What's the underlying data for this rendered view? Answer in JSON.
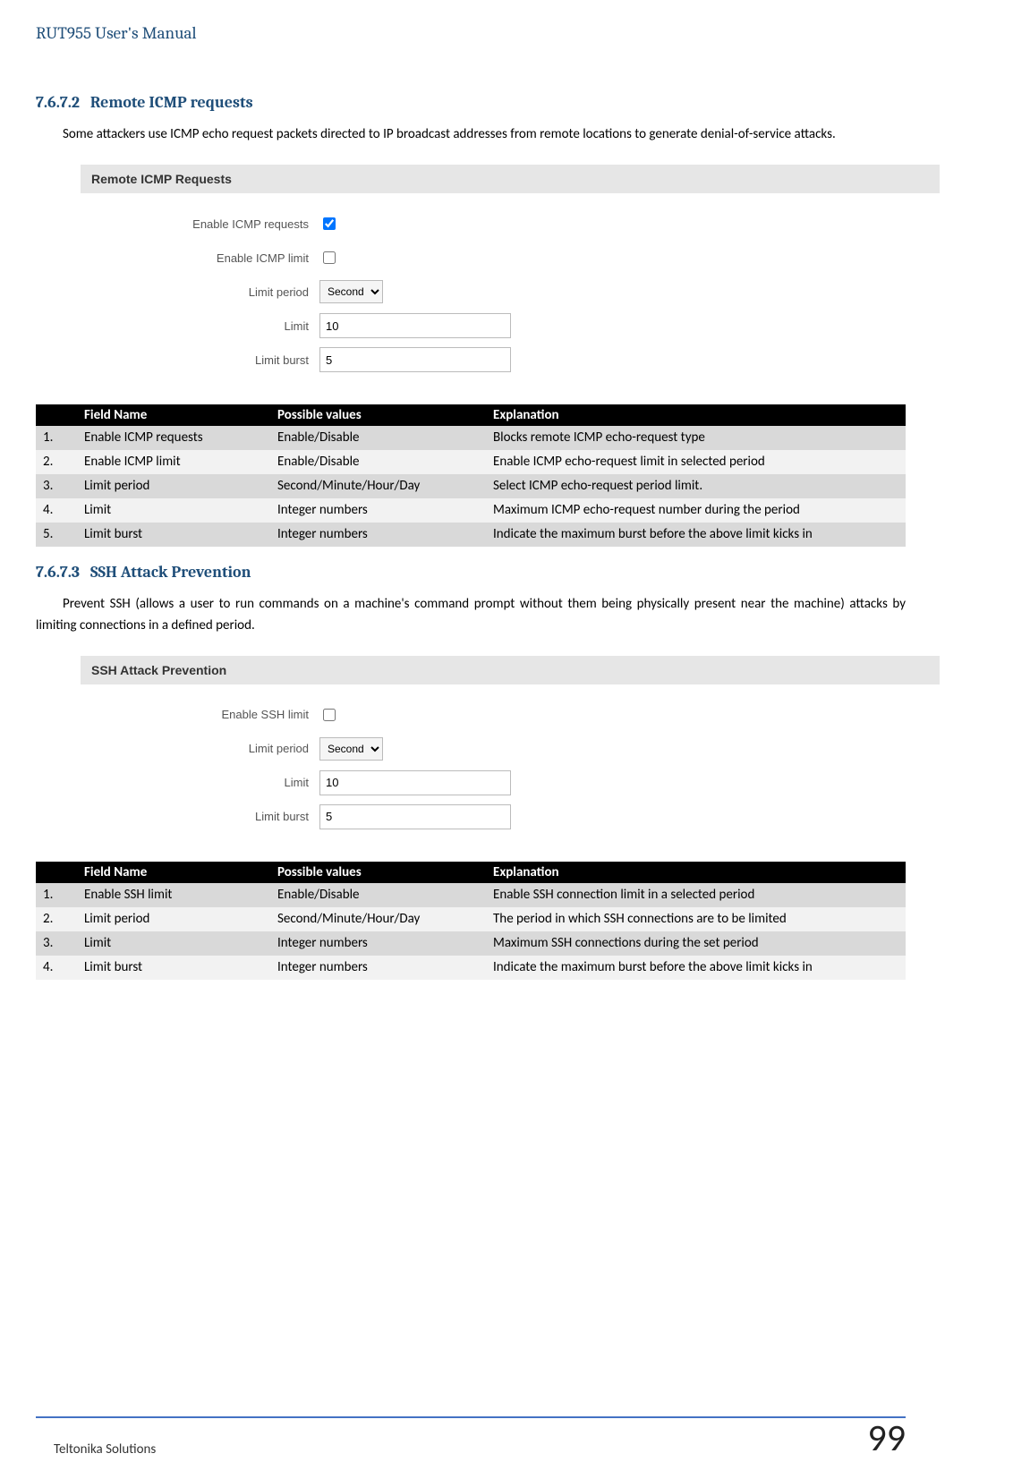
{
  "doc_title": "RUT955 User's Manual",
  "section1": {
    "number": "7.6.7.2",
    "title": "Remote ICMP requests",
    "para": "Some attackers use ICMP echo request packets directed to IP broadcast addresses from remote locations to generate denial-of-service attacks."
  },
  "screenshot1": {
    "header": "Remote ICMP Requests",
    "rows": {
      "enable_req": {
        "label": "Enable ICMP requests",
        "checked": true
      },
      "enable_limit": {
        "label": "Enable ICMP limit",
        "checked": false
      },
      "limit_period": {
        "label": "Limit period",
        "value": "Second"
      },
      "limit": {
        "label": "Limit",
        "value": "10"
      },
      "limit_burst": {
        "label": "Limit burst",
        "value": "5"
      }
    }
  },
  "table1": {
    "headers": {
      "num": "",
      "field": "Field Name",
      "vals": "Possible values",
      "expl": "Explanation"
    },
    "rows": [
      {
        "n": "1.",
        "name": "Enable ICMP requests",
        "vals": "Enable/Disable",
        "expl": "Blocks remote ICMP echo-request type"
      },
      {
        "n": "2.",
        "name": "Enable ICMP limit",
        "vals": "Enable/Disable",
        "expl": "Enable ICMP echo-request limit in selected period"
      },
      {
        "n": "3.",
        "name": "Limit period",
        "vals": "Second/Minute/Hour/Day",
        "expl": "Select ICMP echo-request period limit."
      },
      {
        "n": "4.",
        "name": "Limit",
        "vals": "Integer numbers",
        "expl": "Maximum ICMP echo-request number during the period"
      },
      {
        "n": "5.",
        "name": "Limit burst",
        "vals": "Integer numbers",
        "expl": "Indicate the maximum burst before the above limit kicks in"
      }
    ]
  },
  "section2": {
    "number": "7.6.7.3",
    "title": "SSH Attack Prevention",
    "para": "Prevent SSH (allows a user to run commands on a machine's command prompt without them being physically present near the machine) attacks by limiting connections in a defined period."
  },
  "screenshot2": {
    "header": "SSH Attack Prevention",
    "rows": {
      "enable_limit": {
        "label": "Enable SSH limit",
        "checked": false
      },
      "limit_period": {
        "label": "Limit period",
        "value": "Second"
      },
      "limit": {
        "label": "Limit",
        "value": "10"
      },
      "limit_burst": {
        "label": "Limit burst",
        "value": "5"
      }
    }
  },
  "table2": {
    "headers": {
      "num": "",
      "field": "Field Name",
      "vals": "Possible values",
      "expl": "Explanation"
    },
    "rows": [
      {
        "n": "1.",
        "name": "Enable SSH limit",
        "vals": "Enable/Disable",
        "expl": "Enable SSH connection limit in a selected period"
      },
      {
        "n": "2.",
        "name": "Limit period",
        "vals": "Second/Minute/Hour/Day",
        "expl": "The period in which SSH connections are to be limited"
      },
      {
        "n": "3.",
        "name": "Limit",
        "vals": "Integer numbers",
        "expl": "Maximum SSH connections during the set period"
      },
      {
        "n": "4.",
        "name": "Limit burst",
        "vals": "Integer numbers",
        "expl": "Indicate the maximum burst before the above limit kicks in"
      }
    ]
  },
  "footer": {
    "left": "Teltonika Solutions",
    "right": "99"
  }
}
